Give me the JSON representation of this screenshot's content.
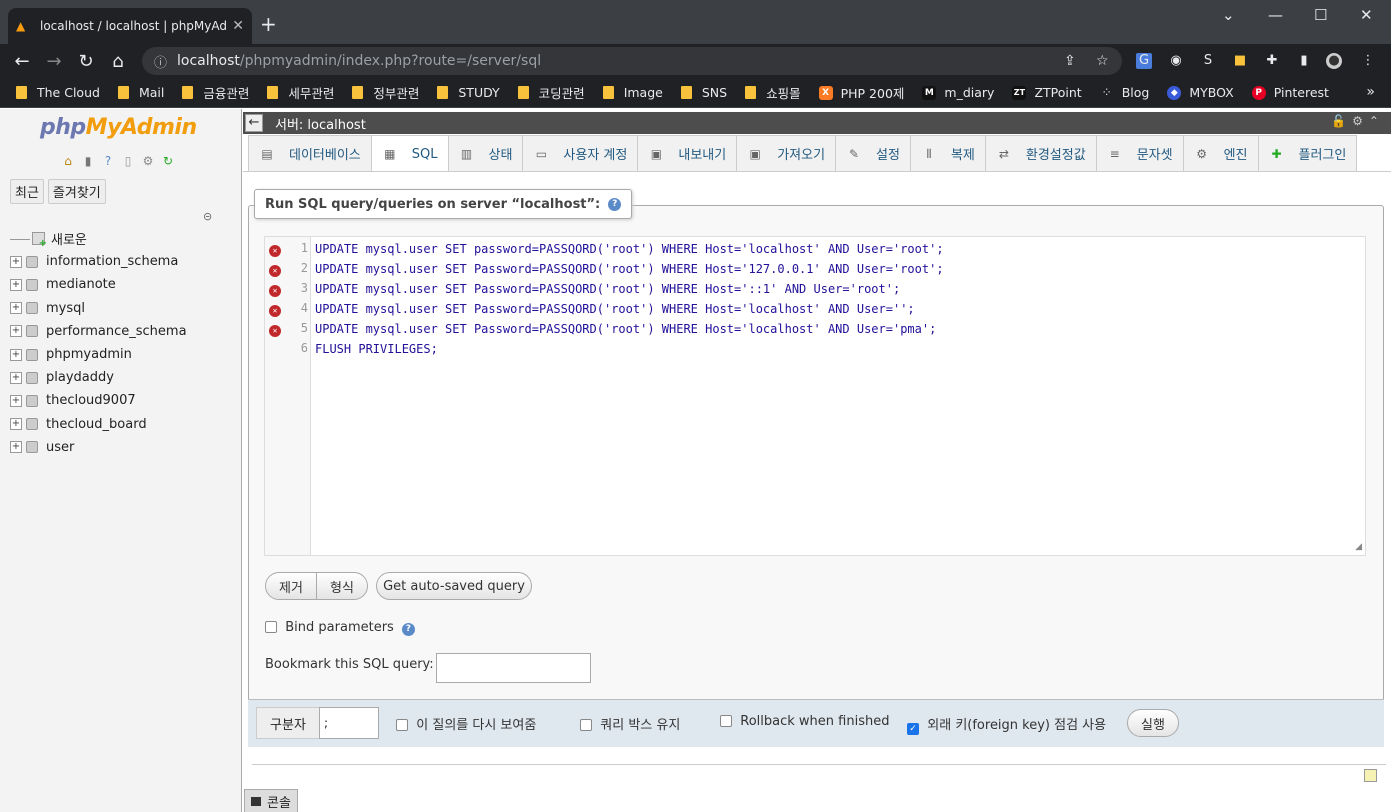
{
  "browser": {
    "tab_title": "localhost / localhost | phpMyAd",
    "url_host": "localhost",
    "url_path": "/phpmyadmin/index.php?route=/server/sql"
  },
  "bookmarks": [
    {
      "label": "The Cloud",
      "icon": "folder-icon"
    },
    {
      "label": "Mail",
      "icon": "folder-icon"
    },
    {
      "label": "금융관련",
      "icon": "folder-icon"
    },
    {
      "label": "세무관련",
      "icon": "folder-icon"
    },
    {
      "label": "정부관련",
      "icon": "folder-icon"
    },
    {
      "label": "STUDY",
      "icon": "folder-icon"
    },
    {
      "label": "코딩관련",
      "icon": "folder-icon"
    },
    {
      "label": "Image",
      "icon": "folder-icon"
    },
    {
      "label": "SNS",
      "icon": "folder-icon"
    },
    {
      "label": "쇼핑몰",
      "icon": "folder-icon"
    },
    {
      "label": "PHP 200제",
      "icon": "xampp-icon"
    },
    {
      "label": "m_diary",
      "icon": "m-icon"
    },
    {
      "label": "ZTPoint",
      "icon": "zt-icon"
    },
    {
      "label": "Blog",
      "icon": "blog-icon"
    },
    {
      "label": "MYBOX",
      "icon": "mybox-icon"
    },
    {
      "label": "Pinterest",
      "icon": "pinterest-icon"
    }
  ],
  "sidebar": {
    "logo_a": "php",
    "logo_b": "MyAdmin",
    "btn_recent": "최근",
    "btn_favorites": "즐겨찾기",
    "new_label": "새로운",
    "databases": [
      "information_schema",
      "medianote",
      "mysql",
      "performance_schema",
      "phpmyadmin",
      "playdaddy",
      "thecloud9007",
      "thecloud_board",
      "user"
    ]
  },
  "server_bar": {
    "label": "서버: localhost"
  },
  "tabs": [
    {
      "label": "데이터베이스",
      "icon": "database-icon"
    },
    {
      "label": "SQL",
      "icon": "sql-icon"
    },
    {
      "label": "상태",
      "icon": "status-icon"
    },
    {
      "label": "사용자 계정",
      "icon": "users-icon"
    },
    {
      "label": "내보내기",
      "icon": "export-icon"
    },
    {
      "label": "가져오기",
      "icon": "import-icon"
    },
    {
      "label": "설정",
      "icon": "wrench-icon"
    },
    {
      "label": "복제",
      "icon": "replication-icon"
    },
    {
      "label": "환경설정값",
      "icon": "variables-icon"
    },
    {
      "label": "문자셋",
      "icon": "charset-icon"
    },
    {
      "label": "엔진",
      "icon": "engine-icon"
    },
    {
      "label": "플러그인",
      "icon": "plugin-icon"
    }
  ],
  "active_tab": "SQL",
  "query_panel": {
    "legend": "Run SQL query/queries on server “localhost”:",
    "lines": [
      "UPDATE mysql.user SET password=PASSQORD('root') WHERE Host='localhost' AND User='root';",
      "UPDATE mysql.user SET Password=PASSQORD('root') WHERE Host='127.0.0.1' AND User='root';",
      "UPDATE mysql.user SET Password=PASSQORD('root') WHERE Host='::1' AND User='root';",
      "UPDATE mysql.user SET Password=PASSQORD('root') WHERE Host='localhost' AND User='';",
      "UPDATE mysql.user SET Password=PASSQORD('root') WHERE Host='localhost' AND User='pma';",
      "FLUSH PRIVILEGES;"
    ],
    "line_numbers": [
      "1",
      "2",
      "3",
      "4",
      "5",
      "6"
    ],
    "error_lines": [
      1,
      2,
      3,
      4,
      5
    ],
    "btn_clear": "제거",
    "btn_format": "형식",
    "btn_autosaved": "Get auto-saved query",
    "bind_parameters": "Bind parameters",
    "bookmark_label": "Bookmark this SQL query:",
    "bookmark_value": ""
  },
  "bottom": {
    "delimiter_label": "구분자",
    "delimiter_value": ";",
    "show_query_again": "이 질의를 다시 보여줌",
    "retain_query_box": "쿼리 박스 유지",
    "rollback": "Rollback when finished",
    "foreign_key": "외래 키(foreign key) 점검 사용",
    "foreign_key_checked": true,
    "go": "실행"
  },
  "console": {
    "label": "콘솔"
  },
  "colors": {
    "accent": "#235a81",
    "folder": "#f9c23c",
    "error": "#c0282b"
  }
}
